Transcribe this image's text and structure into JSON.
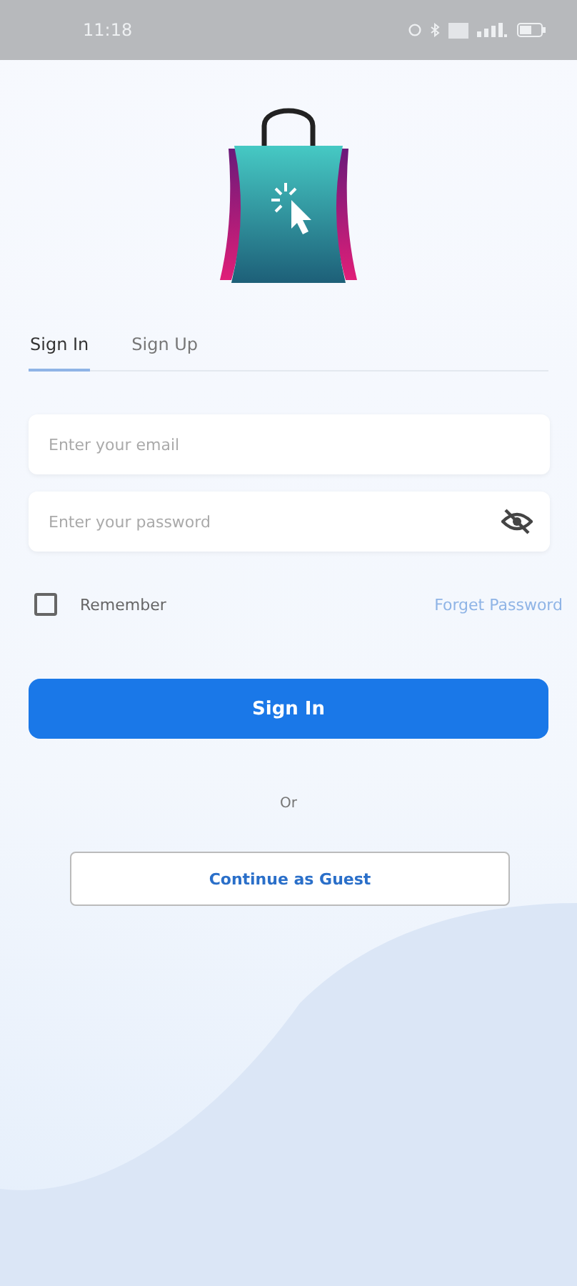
{
  "status_bar": {
    "time": "11:18"
  },
  "tabs": [
    {
      "label": "Sign In",
      "selected": true
    },
    {
      "label": "Sign Up",
      "selected": false
    }
  ],
  "email": {
    "placeholder": "Enter your email"
  },
  "password": {
    "placeholder": "Enter your password"
  },
  "remember": {
    "label": "Remember",
    "checked": false
  },
  "forgot_link": "Forget Password",
  "sign_in_button": "Sign In",
  "separator": "Or",
  "guest_button": "Continue as Guest"
}
